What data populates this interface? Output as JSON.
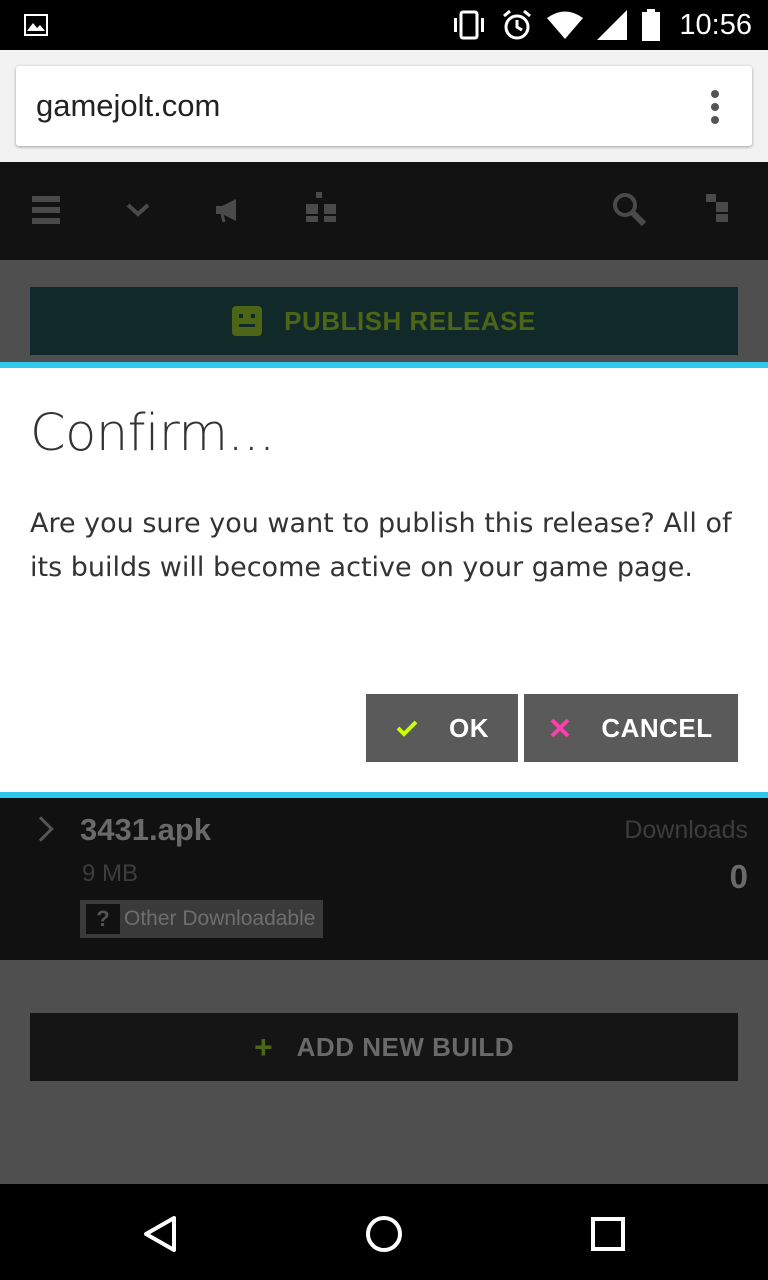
{
  "status_bar": {
    "time": "10:56",
    "icons": [
      "image-notification-icon",
      "vibrate-icon",
      "alarm-icon",
      "wifi-icon",
      "signal-icon",
      "battery-icon"
    ]
  },
  "browser": {
    "url": "gamejolt.com",
    "menu_icon": "overflow-menu-icon"
  },
  "site_nav": {
    "icons": [
      "hamburger-menu-icon",
      "chevron-down-icon",
      "megaphone-icon",
      "friends-icon",
      "search-icon",
      "user-icon"
    ]
  },
  "page": {
    "publish_button": {
      "label": "PUBLISH RELEASE",
      "icon": "jolt-bot-icon"
    },
    "build": {
      "name": "3431.apk",
      "size": "9 MB",
      "type_badge": "?",
      "type": "Other Downloadable",
      "downloads_label": "Downloads",
      "downloads_count": "0"
    },
    "add_build_button": {
      "label": "ADD NEW BUILD",
      "icon_text": "+"
    }
  },
  "dialog": {
    "title": "Confirm...",
    "message": "Are you sure you want to publish this release? All of its builds will become active on your game page.",
    "ok_label": "OK",
    "cancel_label": "CANCEL"
  },
  "colors": {
    "accent": "#2ec8ec",
    "ok_check": "#ccff00",
    "cancel_x": "#ff3dac",
    "jolt_green": "#4d6516"
  },
  "android_nav": {
    "icons": [
      "back-icon",
      "home-icon",
      "recents-icon"
    ]
  }
}
